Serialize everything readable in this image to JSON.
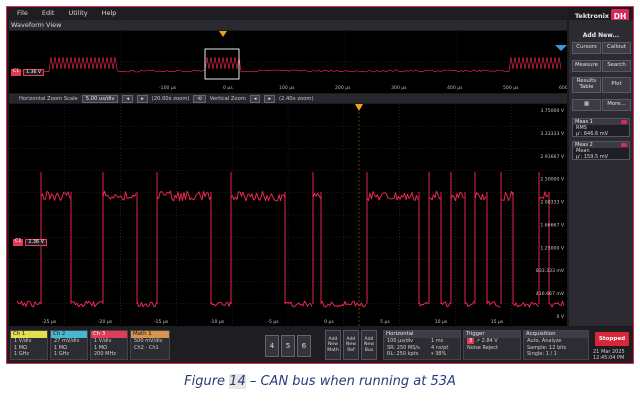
{
  "menu": [
    "File",
    "Edit",
    "Utility",
    "Help"
  ],
  "brand": {
    "text": "Tektronix",
    "badge": "DH"
  },
  "waveform_view": {
    "title": "Waveform View"
  },
  "overview": {
    "ch_marker": "C1",
    "level_label": "1.36 V",
    "ticks": [
      "0 μs",
      "100 μs",
      "200 μs",
      "300 μs",
      "400 μs",
      "500 μs",
      "600 μs"
    ],
    "neg_tick": "-100 μs"
  },
  "zoom_bar": {
    "label": "Horizontal Zoom Scale",
    "value": "5.00 us/div",
    "zoom_factor": "(20.00x zoom)",
    "vz_label": "Vertical Zoom",
    "vz_factor": "(2.40x zoom)"
  },
  "main_plot": {
    "right_labels": [
      "3.75000 V",
      "3.33333 V",
      "2.91667 V",
      "2.50000 V",
      "2.08333 V",
      "1.66667 V",
      "1.25000 V",
      "833.333 mV",
      "416.667 mV",
      "0 V"
    ],
    "x_ticks": [
      "-25 μs",
      "-20 μs",
      "-15 μs",
      "-10 μs",
      "-5 μs",
      "0 μs",
      "5 μs",
      "10 μs",
      "15 μs"
    ],
    "ch_tag": "C1",
    "level": "1.36 V",
    "trigger_marker": "T"
  },
  "right_panel": {
    "add_new": "Add New...",
    "buttons": [
      "Cursors",
      "Callout",
      "Measure",
      "Search",
      "Results Table",
      "Plot",
      "More..."
    ],
    "meas": [
      {
        "title": "Meas 1",
        "name": "RMS",
        "value": "μ': 646.6 mV"
      },
      {
        "title": "Meas 2",
        "name": "Mean",
        "value": "μ': 159.5 mV"
      }
    ]
  },
  "bottom": {
    "channels": [
      {
        "head": "Ch 1",
        "lines": [
          "1 V/div",
          "1 MΩ",
          "1 GHz"
        ],
        "color": "#e5e04a"
      },
      {
        "head": "Ch 2",
        "lines": [
          "27 mV/div",
          "1 MΩ",
          "1 GHz"
        ],
        "color": "#46b8d2"
      },
      {
        "head": "Ch 3",
        "lines": [
          "1 V/div",
          "1 MΩ",
          "200 MHz"
        ],
        "color": "#e23b57"
      },
      {
        "head": "Math 1",
        "lines": [
          "500 mV/div",
          "Ch2 - Ch1"
        ],
        "color": "#d8944a"
      }
    ],
    "num_buttons": [
      "4",
      "5",
      "6"
    ],
    "add_buttons": [
      "Add New Math",
      "Add New Ref",
      "Add New Bus"
    ],
    "horizontal": {
      "head": "Horizontal",
      "lines": [
        "100 μs/div",
        "SR: 250 MS/s",
        "RL: 250 kpts"
      ],
      "right": [
        "1 ms",
        "4 ns/pt",
        "38%"
      ]
    },
    "trigger": {
      "head": "Trigger",
      "level": "2.84 V",
      "mode": "Noise Reject"
    },
    "acquisition": {
      "head": "Acquisition",
      "lines": [
        "Auto, Analyze",
        "Sample: 12 bits",
        "Single: 1 / 1"
      ]
    },
    "status": "Stopped",
    "date": "21 Mar 2025",
    "time": "12:45:04 PM"
  },
  "caption": {
    "prefix": "Figure ",
    "number": "14",
    "text": " – CAN bus when running at 53A"
  },
  "colors": {
    "trace": "#ff2a55",
    "accent": "#d6285a",
    "frame": "#e0304a"
  }
}
